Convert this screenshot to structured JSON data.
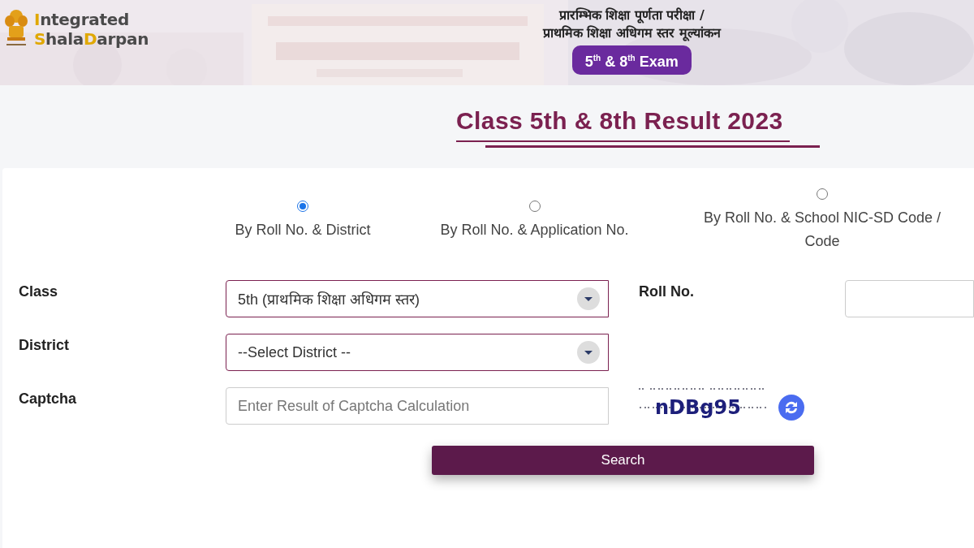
{
  "header": {
    "logo": {
      "lines": [
        [
          {
            "text": "I",
            "accent": true
          },
          {
            "text": "ntegrated",
            "accent": false
          }
        ],
        [
          {
            "text": "S",
            "accent": true
          },
          {
            "text": "hala",
            "accent": false
          },
          {
            "text": "D",
            "accent": true
          },
          {
            "text": "arpan",
            "accent": false
          }
        ]
      ]
    },
    "heading_lines": [
      "प्रारम्भिक शिक्षा पूर्णता परीक्षा /",
      "प्राथमिक शिक्षा अधिगम स्तर मूल्यांकन"
    ],
    "badge": "5$^{th}$ & 8$^{th}$ Exam"
  },
  "title": "Class 5th & 8th Result 2023",
  "search_options": [
    {
      "label_lines": [
        "By Roll No. & District"
      ],
      "selected": true
    },
    {
      "label_lines": [
        "By Roll No. & Application No."
      ],
      "selected": false
    },
    {
      "label_lines": [
        "By Roll No. & School NIC-SD Code /",
        "Code"
      ],
      "selected": false
    }
  ],
  "form": {
    "class": {
      "label": "Class",
      "value": "5th (प्राथमिक शिक्षा अधिगम स्तर)"
    },
    "roll_no": {
      "label": "Roll No."
    },
    "district": {
      "label": "District",
      "value": "--Select District --"
    },
    "captcha": {
      "label": "Captcha",
      "placeholder": "Enter Result of Captcha Calculation",
      "code": "nDBg95"
    },
    "search_button": "Search"
  }
}
